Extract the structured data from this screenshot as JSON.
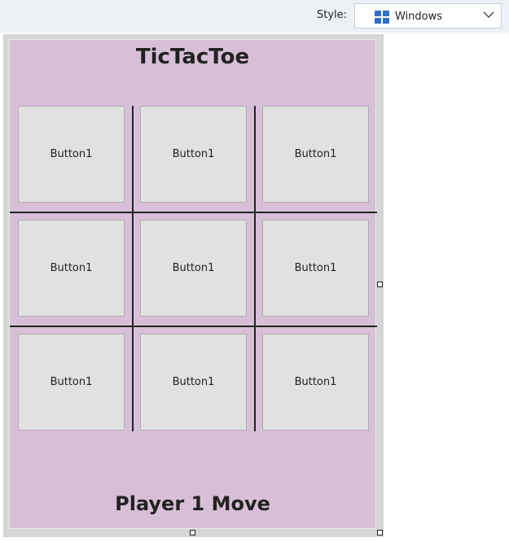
{
  "toolbar": {
    "style_label": "Style:",
    "style_value": "Windows",
    "icon": "windows-icon",
    "accent": "#2f6fc6"
  },
  "form": {
    "title": "TicTacToe",
    "status": "Player 1 Move",
    "background": "#d8bfd8",
    "buttons": [
      {
        "label": "Button1"
      },
      {
        "label": "Button1"
      },
      {
        "label": "Button1"
      },
      {
        "label": "Button1"
      },
      {
        "label": "Button1"
      },
      {
        "label": "Button1"
      },
      {
        "label": "Button1"
      },
      {
        "label": "Button1"
      },
      {
        "label": "Button1"
      }
    ]
  }
}
